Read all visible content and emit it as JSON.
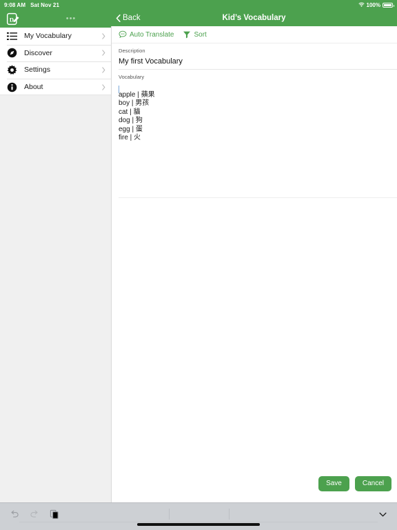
{
  "colors": {
    "brand_green": "#4CA14E",
    "sidebar_bg": "#F0F0F0",
    "bottom_bar": "#CDD0D4"
  },
  "status_bar": {
    "time": "9:08 AM",
    "date": "Sat Nov 21",
    "wifi_icon": "wifi-icon",
    "battery_percent": "100%",
    "battery_icon": "battery-full-icon"
  },
  "header": {
    "logo_icon": "app-logo-icon",
    "overflow_label": "•••",
    "back_label": "Back",
    "back_icon": "chevron-left-icon",
    "title": "Kid’s Vocabulary"
  },
  "sidebar": {
    "items": [
      {
        "label": "My Vocabulary",
        "icon": "list-icon",
        "chevron": "chevron-right-icon"
      },
      {
        "label": "Discover",
        "icon": "compass-icon",
        "chevron": "chevron-right-icon"
      },
      {
        "label": "Settings",
        "icon": "gear-icon",
        "chevron": "chevron-right-icon"
      },
      {
        "label": "About",
        "icon": "info-icon",
        "chevron": "chevron-right-icon"
      }
    ]
  },
  "main": {
    "toolbar": {
      "auto_translate_label": "Auto Translate",
      "auto_translate_icon": "speech-bubble-icon",
      "sort_label": "Sort",
      "sort_icon": "funnel-icon"
    },
    "description_field": {
      "label": "Description",
      "value": "My first Vocabulary",
      "placeholder": "Description"
    },
    "vocabulary_field": {
      "label": "Vocabulary",
      "placeholder": "Vocabulary",
      "lines": [
        "apple | 蘋果",
        "boy | 男孩",
        "cat | 貓",
        "dog | 狗",
        "egg | 蛋",
        "fire | 火"
      ]
    },
    "save_label": "Save",
    "cancel_label": "Cancel"
  },
  "bottom_bar": {
    "undo_icon": "undo-icon",
    "redo_icon": "redo-icon",
    "paste_icon": "paste-icon",
    "dismiss_icon": "chevron-down-icon"
  }
}
